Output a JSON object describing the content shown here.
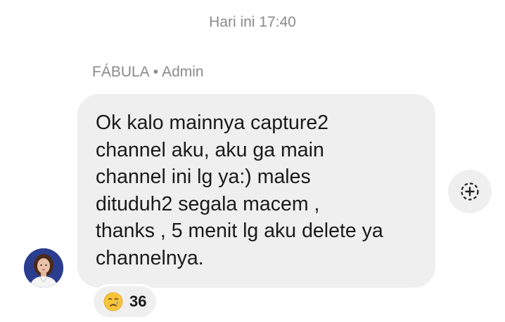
{
  "chat": {
    "timestamp": "Hari ini 17:40",
    "sender": {
      "name": "FÁBULA",
      "separator": "•",
      "role": "Admin"
    },
    "message": {
      "text": "Ok kalo mainnya capture2\nchannel aku, aku ga main\nchannel ini lg ya:) males\ndituduh2 segala macem ,\nthanks , 5 menit lg aku delete ya\nchannelnya."
    },
    "reaction": {
      "emoji_icon": "crying-face-icon",
      "count": "36"
    },
    "add_reaction_icon": "add-reaction-icon"
  },
  "colors": {
    "bubble": "#efefef",
    "muted_text": "#8a8a8a",
    "text": "#1a1a1a",
    "avatar_bg": "#2a3d8f"
  }
}
